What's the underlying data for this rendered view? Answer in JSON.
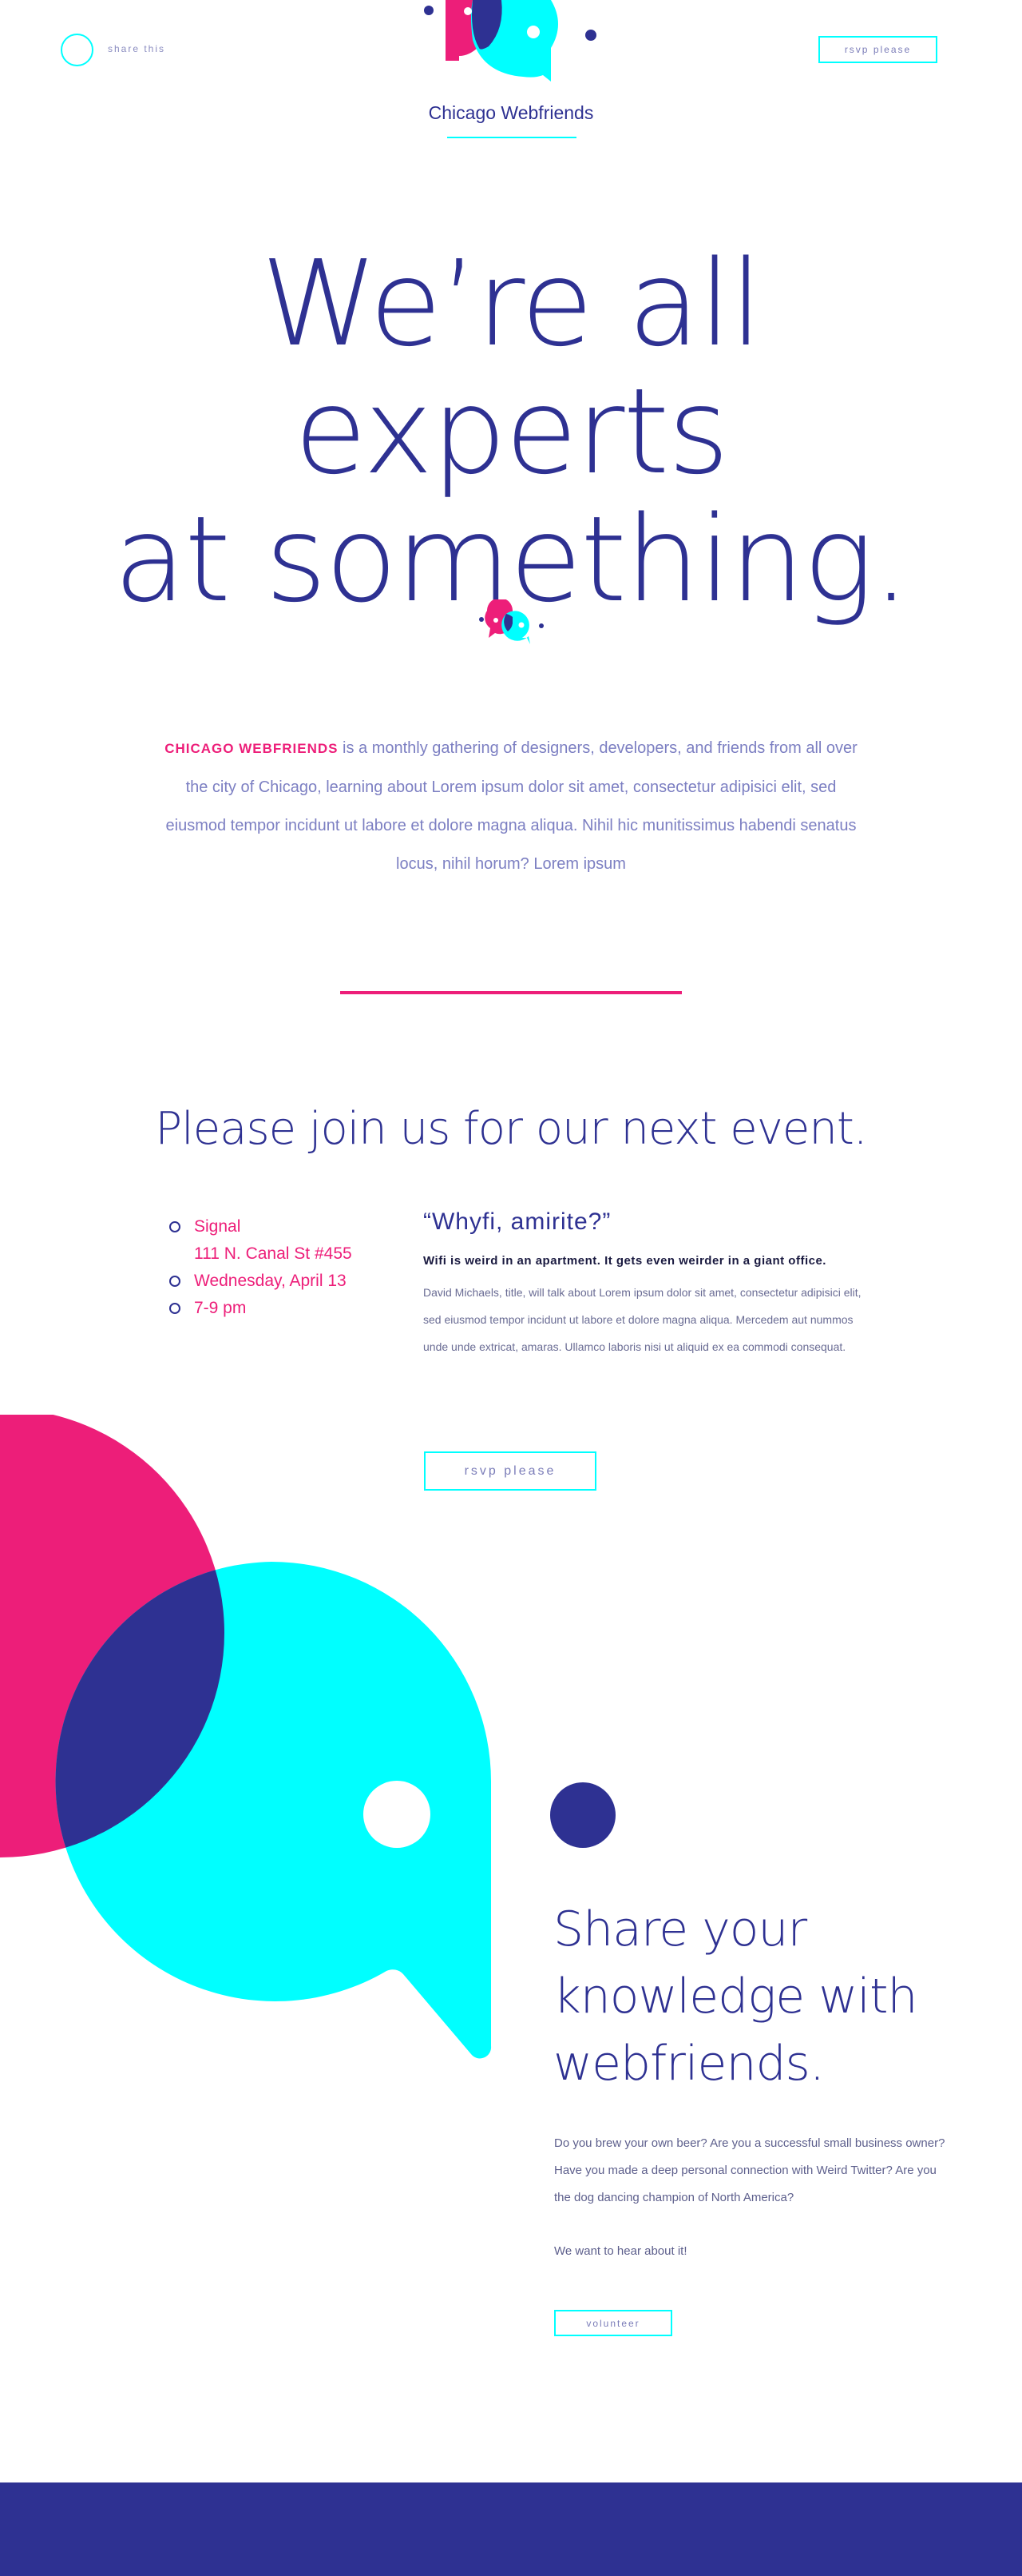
{
  "header": {
    "share_label": "share this",
    "rsvp_label": "rsvp please",
    "brand_name": "Chicago Webfriends"
  },
  "hero": {
    "line1": "We’re all experts",
    "line2": "at something."
  },
  "intro": {
    "brand": "CHICAGO WEBFRIENDS",
    "text": " is a monthly gathering of designers, developers, and friends from all over the city of Chicago, learning about Lorem ipsum dolor sit amet, consectetur adipisici elit, sed eiusmod tempor incidunt ut labore et dolore magna aliqua. Nihil hic munitissimus habendi senatus locus, nihil horum? Lorem ipsum"
  },
  "event": {
    "title": "Please join us for our next event.",
    "venue": "Signal",
    "address": "111 N. Canal St #455",
    "date": "Wednesday, April 13",
    "time": "7-9 pm",
    "talk_title": "“Whyfi, amirite?”",
    "talk_headline": "Wifi is weird in an apartment. It gets even weirder in a giant office.",
    "talk_body": "David Michaels, title, will talk about Lorem ipsum dolor sit amet, consectetur adipisici elit, sed eiusmod tempor incidunt ut labore et dolore magna aliqua. Mercedem aut nummos unde unde extricat, amaras. Ullamco laboris nisi ut aliquid ex ea commodi consequat.",
    "rsvp_label": "rsvp please"
  },
  "share": {
    "title": "Share your knowledge with webfriends.",
    "body": "Do you brew your own beer? Are you a successful small business owner? Have you made a deep personal connection with Weird Twitter? Are you the dog dancing champion of North America?",
    "body2": "We want to hear about it!",
    "volunteer_label": "volunteer"
  },
  "colors": {
    "navy": "#2e3192",
    "pink": "#ed1e79",
    "cyan": "#00ffff",
    "white": "#ffffff"
  },
  "icons": {
    "brand_logo": "speech-bubbles-logo-icon",
    "share": "share-circle-icon"
  }
}
